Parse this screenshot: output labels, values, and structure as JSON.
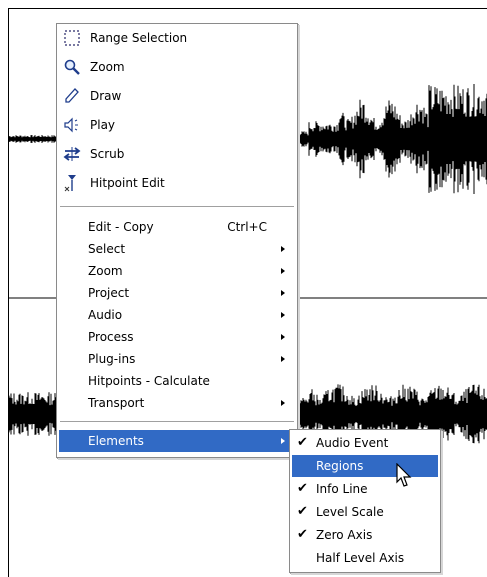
{
  "colors": {
    "highlight": "#316ac5",
    "waveform": "#000000",
    "menu_bg": "#ffffff"
  },
  "menu": {
    "tools": [
      {
        "label": "Range Selection",
        "icon": "range-selection-icon"
      },
      {
        "label": "Zoom",
        "icon": "magnifier-icon"
      },
      {
        "label": "Draw",
        "icon": "pencil-icon"
      },
      {
        "label": "Play",
        "icon": "speaker-icon"
      },
      {
        "label": "Scrub",
        "icon": "scrub-icon"
      },
      {
        "label": "Hitpoint Edit",
        "icon": "hitpoint-icon"
      }
    ],
    "commands": [
      {
        "label": "Edit - Copy",
        "shortcut": "Ctrl+C",
        "submenu": false
      },
      {
        "label": "Select",
        "submenu": true
      },
      {
        "label": "Zoom",
        "submenu": true
      },
      {
        "label": "Project",
        "submenu": true
      },
      {
        "label": "Audio",
        "submenu": true
      },
      {
        "label": "Process",
        "submenu": true
      },
      {
        "label": "Plug-ins",
        "submenu": true
      },
      {
        "label": "Hitpoints - Calculate",
        "submenu": false
      },
      {
        "label": "Transport",
        "submenu": true
      }
    ],
    "elements": {
      "label": "Elements",
      "submenu": true,
      "highlighted": true
    }
  },
  "submenu": {
    "items": [
      {
        "label": "Audio Event",
        "checked": "✔",
        "highlighted": false
      },
      {
        "label": "Regions",
        "checked": "",
        "highlighted": true
      },
      {
        "label": "Info Line",
        "checked": "✔",
        "highlighted": false
      },
      {
        "label": "Level Scale",
        "checked": "✔",
        "highlighted": false
      },
      {
        "label": "Zero Axis",
        "checked": "✔",
        "highlighted": false
      },
      {
        "label": "Half Level Axis",
        "checked": "",
        "highlighted": false
      }
    ]
  }
}
